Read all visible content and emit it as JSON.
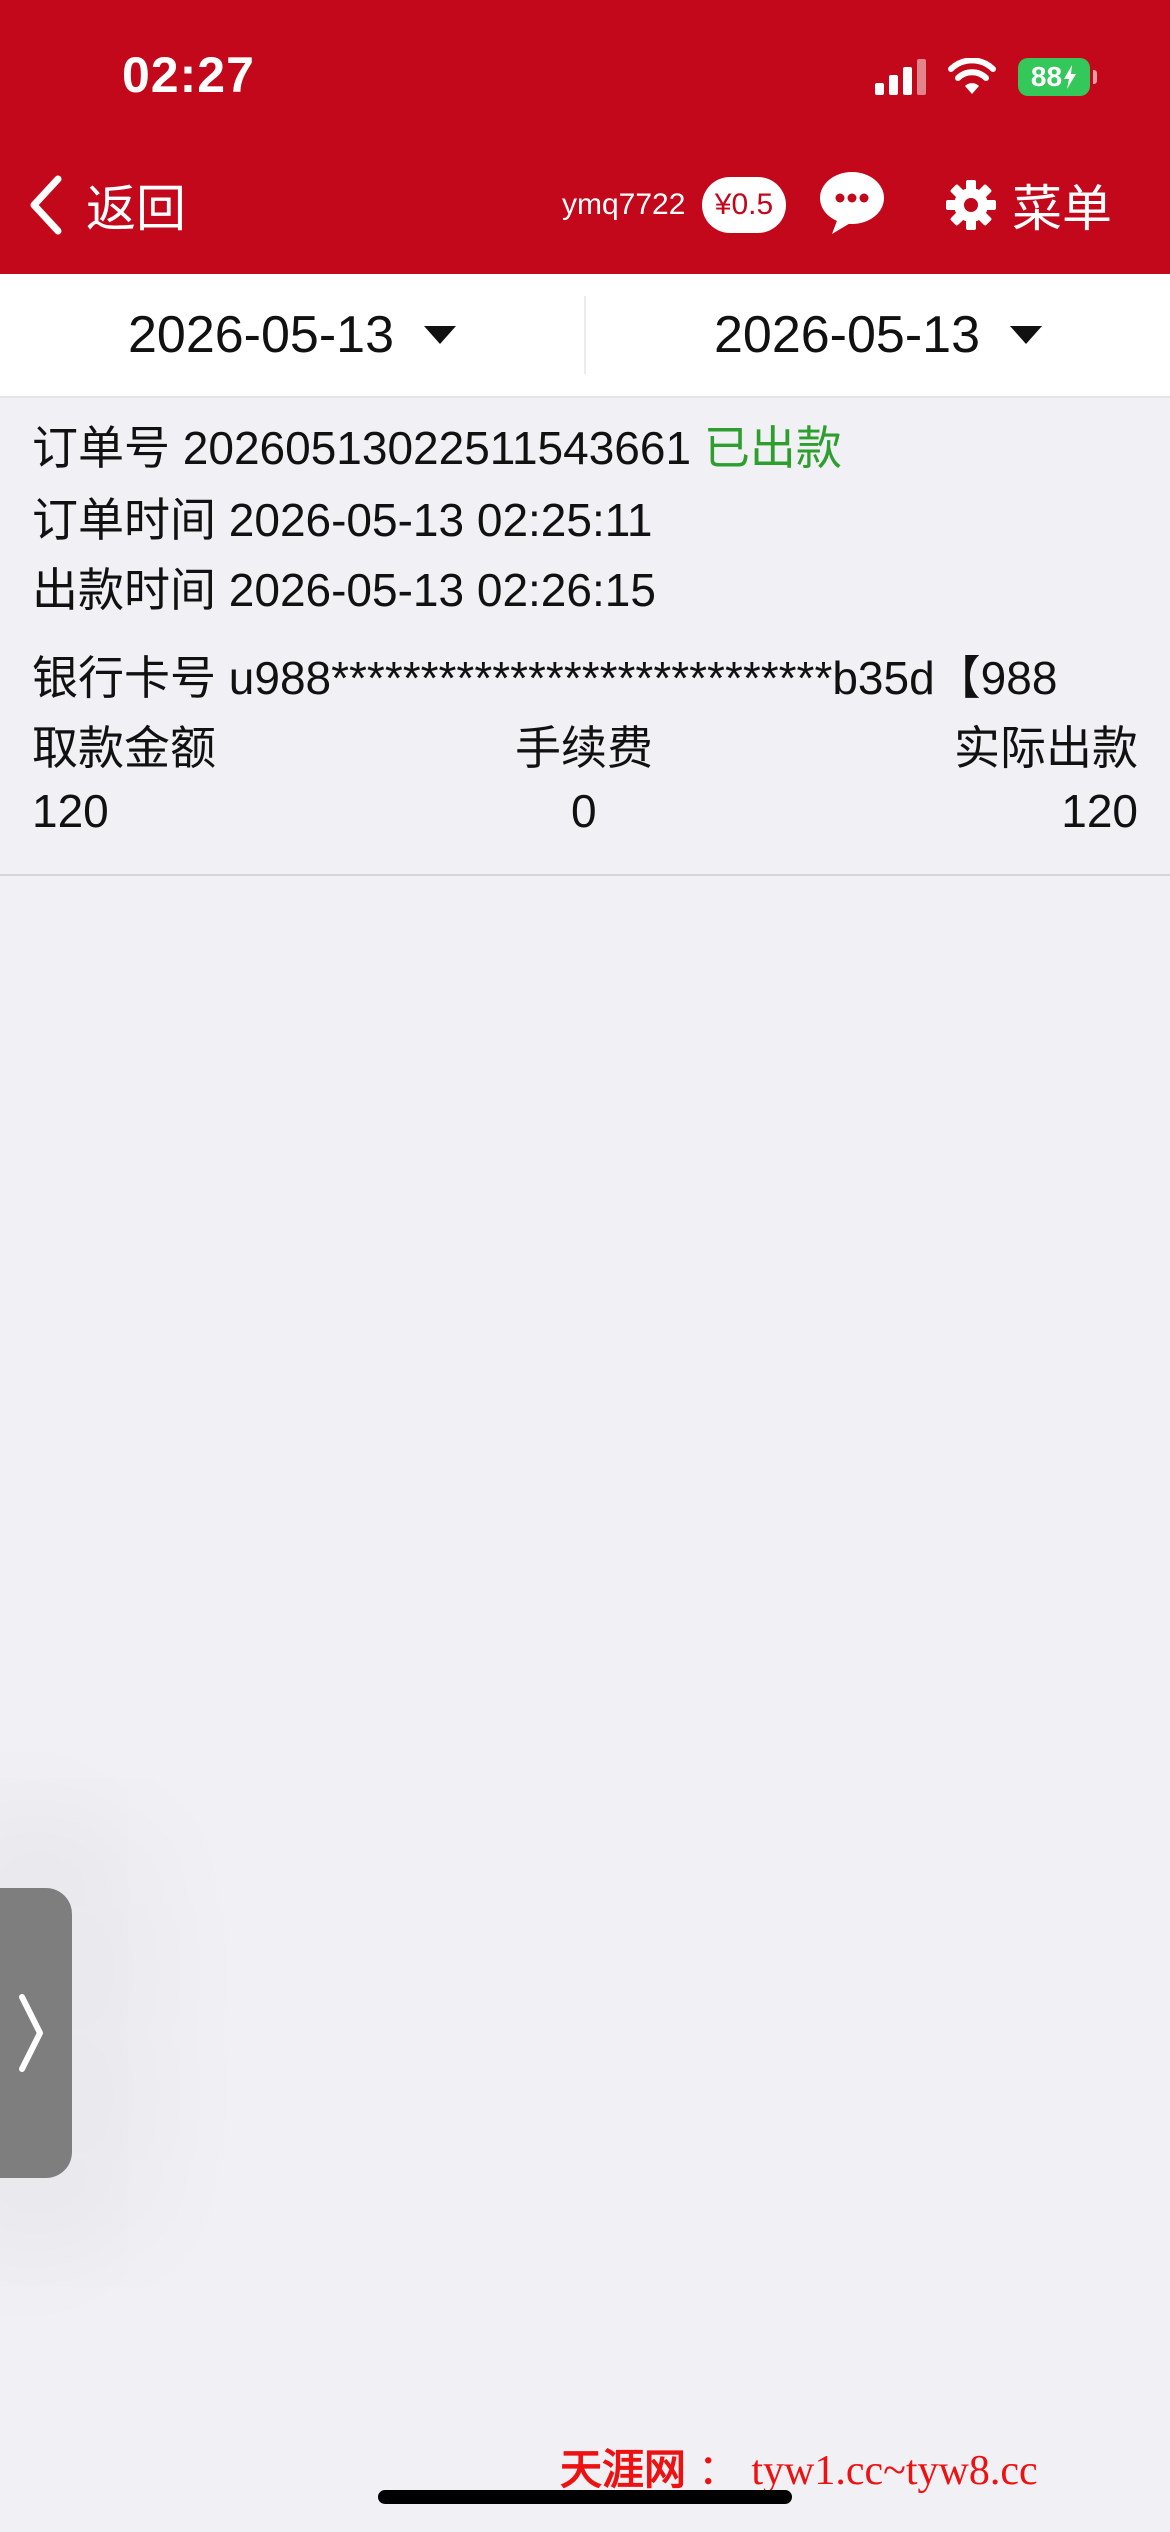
{
  "status_bar": {
    "time": "02:27",
    "battery": "88"
  },
  "header": {
    "back_label": "返回",
    "username": "ymq7722",
    "balance": "¥0.5",
    "menu_label": "菜单"
  },
  "date_filter": {
    "start_date": "2026-05-13",
    "end_date": "2026-05-13"
  },
  "order": {
    "number_label": "订单号",
    "number": "20260513022511543661",
    "status": "已出款",
    "order_time_label": "订单时间",
    "order_time": "2026-05-13 02:25:11",
    "payout_time_label": "出款时间",
    "payout_time": "2026-05-13 02:26:15",
    "bank_card_label": "银行卡号",
    "bank_card": "u988****************************b35d【988",
    "columns": [
      "取款金额",
      "手续费",
      "实际出款"
    ],
    "values": [
      "120",
      "0",
      "120"
    ]
  },
  "watermark": {
    "name": "天涯网",
    "separator": "：",
    "url": "tyw1.cc~tyw8.cc"
  }
}
